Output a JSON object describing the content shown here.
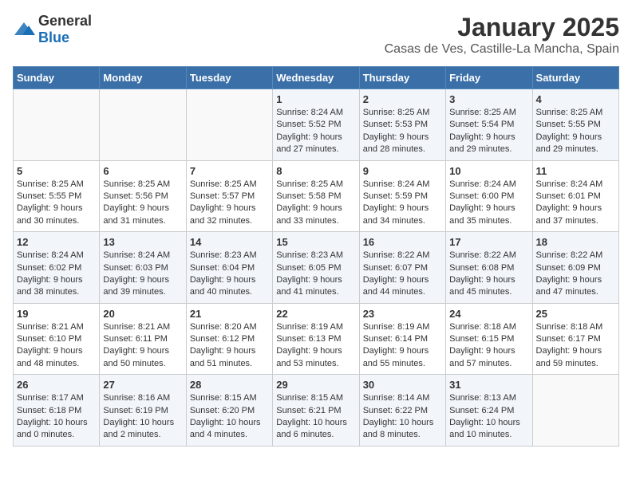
{
  "logo": {
    "general": "General",
    "blue": "Blue"
  },
  "title": "January 2025",
  "subtitle": "Casas de Ves, Castille-La Mancha, Spain",
  "headers": [
    "Sunday",
    "Monday",
    "Tuesday",
    "Wednesday",
    "Thursday",
    "Friday",
    "Saturday"
  ],
  "weeks": [
    [
      {
        "day": "",
        "content": ""
      },
      {
        "day": "",
        "content": ""
      },
      {
        "day": "",
        "content": ""
      },
      {
        "day": "1",
        "content": "Sunrise: 8:24 AM\nSunset: 5:52 PM\nDaylight: 9 hours and 27 minutes."
      },
      {
        "day": "2",
        "content": "Sunrise: 8:25 AM\nSunset: 5:53 PM\nDaylight: 9 hours and 28 minutes."
      },
      {
        "day": "3",
        "content": "Sunrise: 8:25 AM\nSunset: 5:54 PM\nDaylight: 9 hours and 29 minutes."
      },
      {
        "day": "4",
        "content": "Sunrise: 8:25 AM\nSunset: 5:55 PM\nDaylight: 9 hours and 29 minutes."
      }
    ],
    [
      {
        "day": "5",
        "content": "Sunrise: 8:25 AM\nSunset: 5:55 PM\nDaylight: 9 hours and 30 minutes."
      },
      {
        "day": "6",
        "content": "Sunrise: 8:25 AM\nSunset: 5:56 PM\nDaylight: 9 hours and 31 minutes."
      },
      {
        "day": "7",
        "content": "Sunrise: 8:25 AM\nSunset: 5:57 PM\nDaylight: 9 hours and 32 minutes."
      },
      {
        "day": "8",
        "content": "Sunrise: 8:25 AM\nSunset: 5:58 PM\nDaylight: 9 hours and 33 minutes."
      },
      {
        "day": "9",
        "content": "Sunrise: 8:24 AM\nSunset: 5:59 PM\nDaylight: 9 hours and 34 minutes."
      },
      {
        "day": "10",
        "content": "Sunrise: 8:24 AM\nSunset: 6:00 PM\nDaylight: 9 hours and 35 minutes."
      },
      {
        "day": "11",
        "content": "Sunrise: 8:24 AM\nSunset: 6:01 PM\nDaylight: 9 hours and 37 minutes."
      }
    ],
    [
      {
        "day": "12",
        "content": "Sunrise: 8:24 AM\nSunset: 6:02 PM\nDaylight: 9 hours and 38 minutes."
      },
      {
        "day": "13",
        "content": "Sunrise: 8:24 AM\nSunset: 6:03 PM\nDaylight: 9 hours and 39 minutes."
      },
      {
        "day": "14",
        "content": "Sunrise: 8:23 AM\nSunset: 6:04 PM\nDaylight: 9 hours and 40 minutes."
      },
      {
        "day": "15",
        "content": "Sunrise: 8:23 AM\nSunset: 6:05 PM\nDaylight: 9 hours and 41 minutes."
      },
      {
        "day": "16",
        "content": "Sunrise: 8:22 AM\nSunset: 6:07 PM\nDaylight: 9 hours and 44 minutes."
      },
      {
        "day": "17",
        "content": "Sunrise: 8:22 AM\nSunset: 6:08 PM\nDaylight: 9 hours and 45 minutes."
      },
      {
        "day": "18",
        "content": "Sunrise: 8:22 AM\nSunset: 6:09 PM\nDaylight: 9 hours and 47 minutes."
      }
    ],
    [
      {
        "day": "19",
        "content": "Sunrise: 8:21 AM\nSunset: 6:10 PM\nDaylight: 9 hours and 48 minutes."
      },
      {
        "day": "20",
        "content": "Sunrise: 8:21 AM\nSunset: 6:11 PM\nDaylight: 9 hours and 50 minutes."
      },
      {
        "day": "21",
        "content": "Sunrise: 8:20 AM\nSunset: 6:12 PM\nDaylight: 9 hours and 51 minutes."
      },
      {
        "day": "22",
        "content": "Sunrise: 8:19 AM\nSunset: 6:13 PM\nDaylight: 9 hours and 53 minutes."
      },
      {
        "day": "23",
        "content": "Sunrise: 8:19 AM\nSunset: 6:14 PM\nDaylight: 9 hours and 55 minutes."
      },
      {
        "day": "24",
        "content": "Sunrise: 8:18 AM\nSunset: 6:15 PM\nDaylight: 9 hours and 57 minutes."
      },
      {
        "day": "25",
        "content": "Sunrise: 8:18 AM\nSunset: 6:17 PM\nDaylight: 9 hours and 59 minutes."
      }
    ],
    [
      {
        "day": "26",
        "content": "Sunrise: 8:17 AM\nSunset: 6:18 PM\nDaylight: 10 hours and 0 minutes."
      },
      {
        "day": "27",
        "content": "Sunrise: 8:16 AM\nSunset: 6:19 PM\nDaylight: 10 hours and 2 minutes."
      },
      {
        "day": "28",
        "content": "Sunrise: 8:15 AM\nSunset: 6:20 PM\nDaylight: 10 hours and 4 minutes."
      },
      {
        "day": "29",
        "content": "Sunrise: 8:15 AM\nSunset: 6:21 PM\nDaylight: 10 hours and 6 minutes."
      },
      {
        "day": "30",
        "content": "Sunrise: 8:14 AM\nSunset: 6:22 PM\nDaylight: 10 hours and 8 minutes."
      },
      {
        "day": "31",
        "content": "Sunrise: 8:13 AM\nSunset: 6:24 PM\nDaylight: 10 hours and 10 minutes."
      },
      {
        "day": "",
        "content": ""
      }
    ]
  ]
}
